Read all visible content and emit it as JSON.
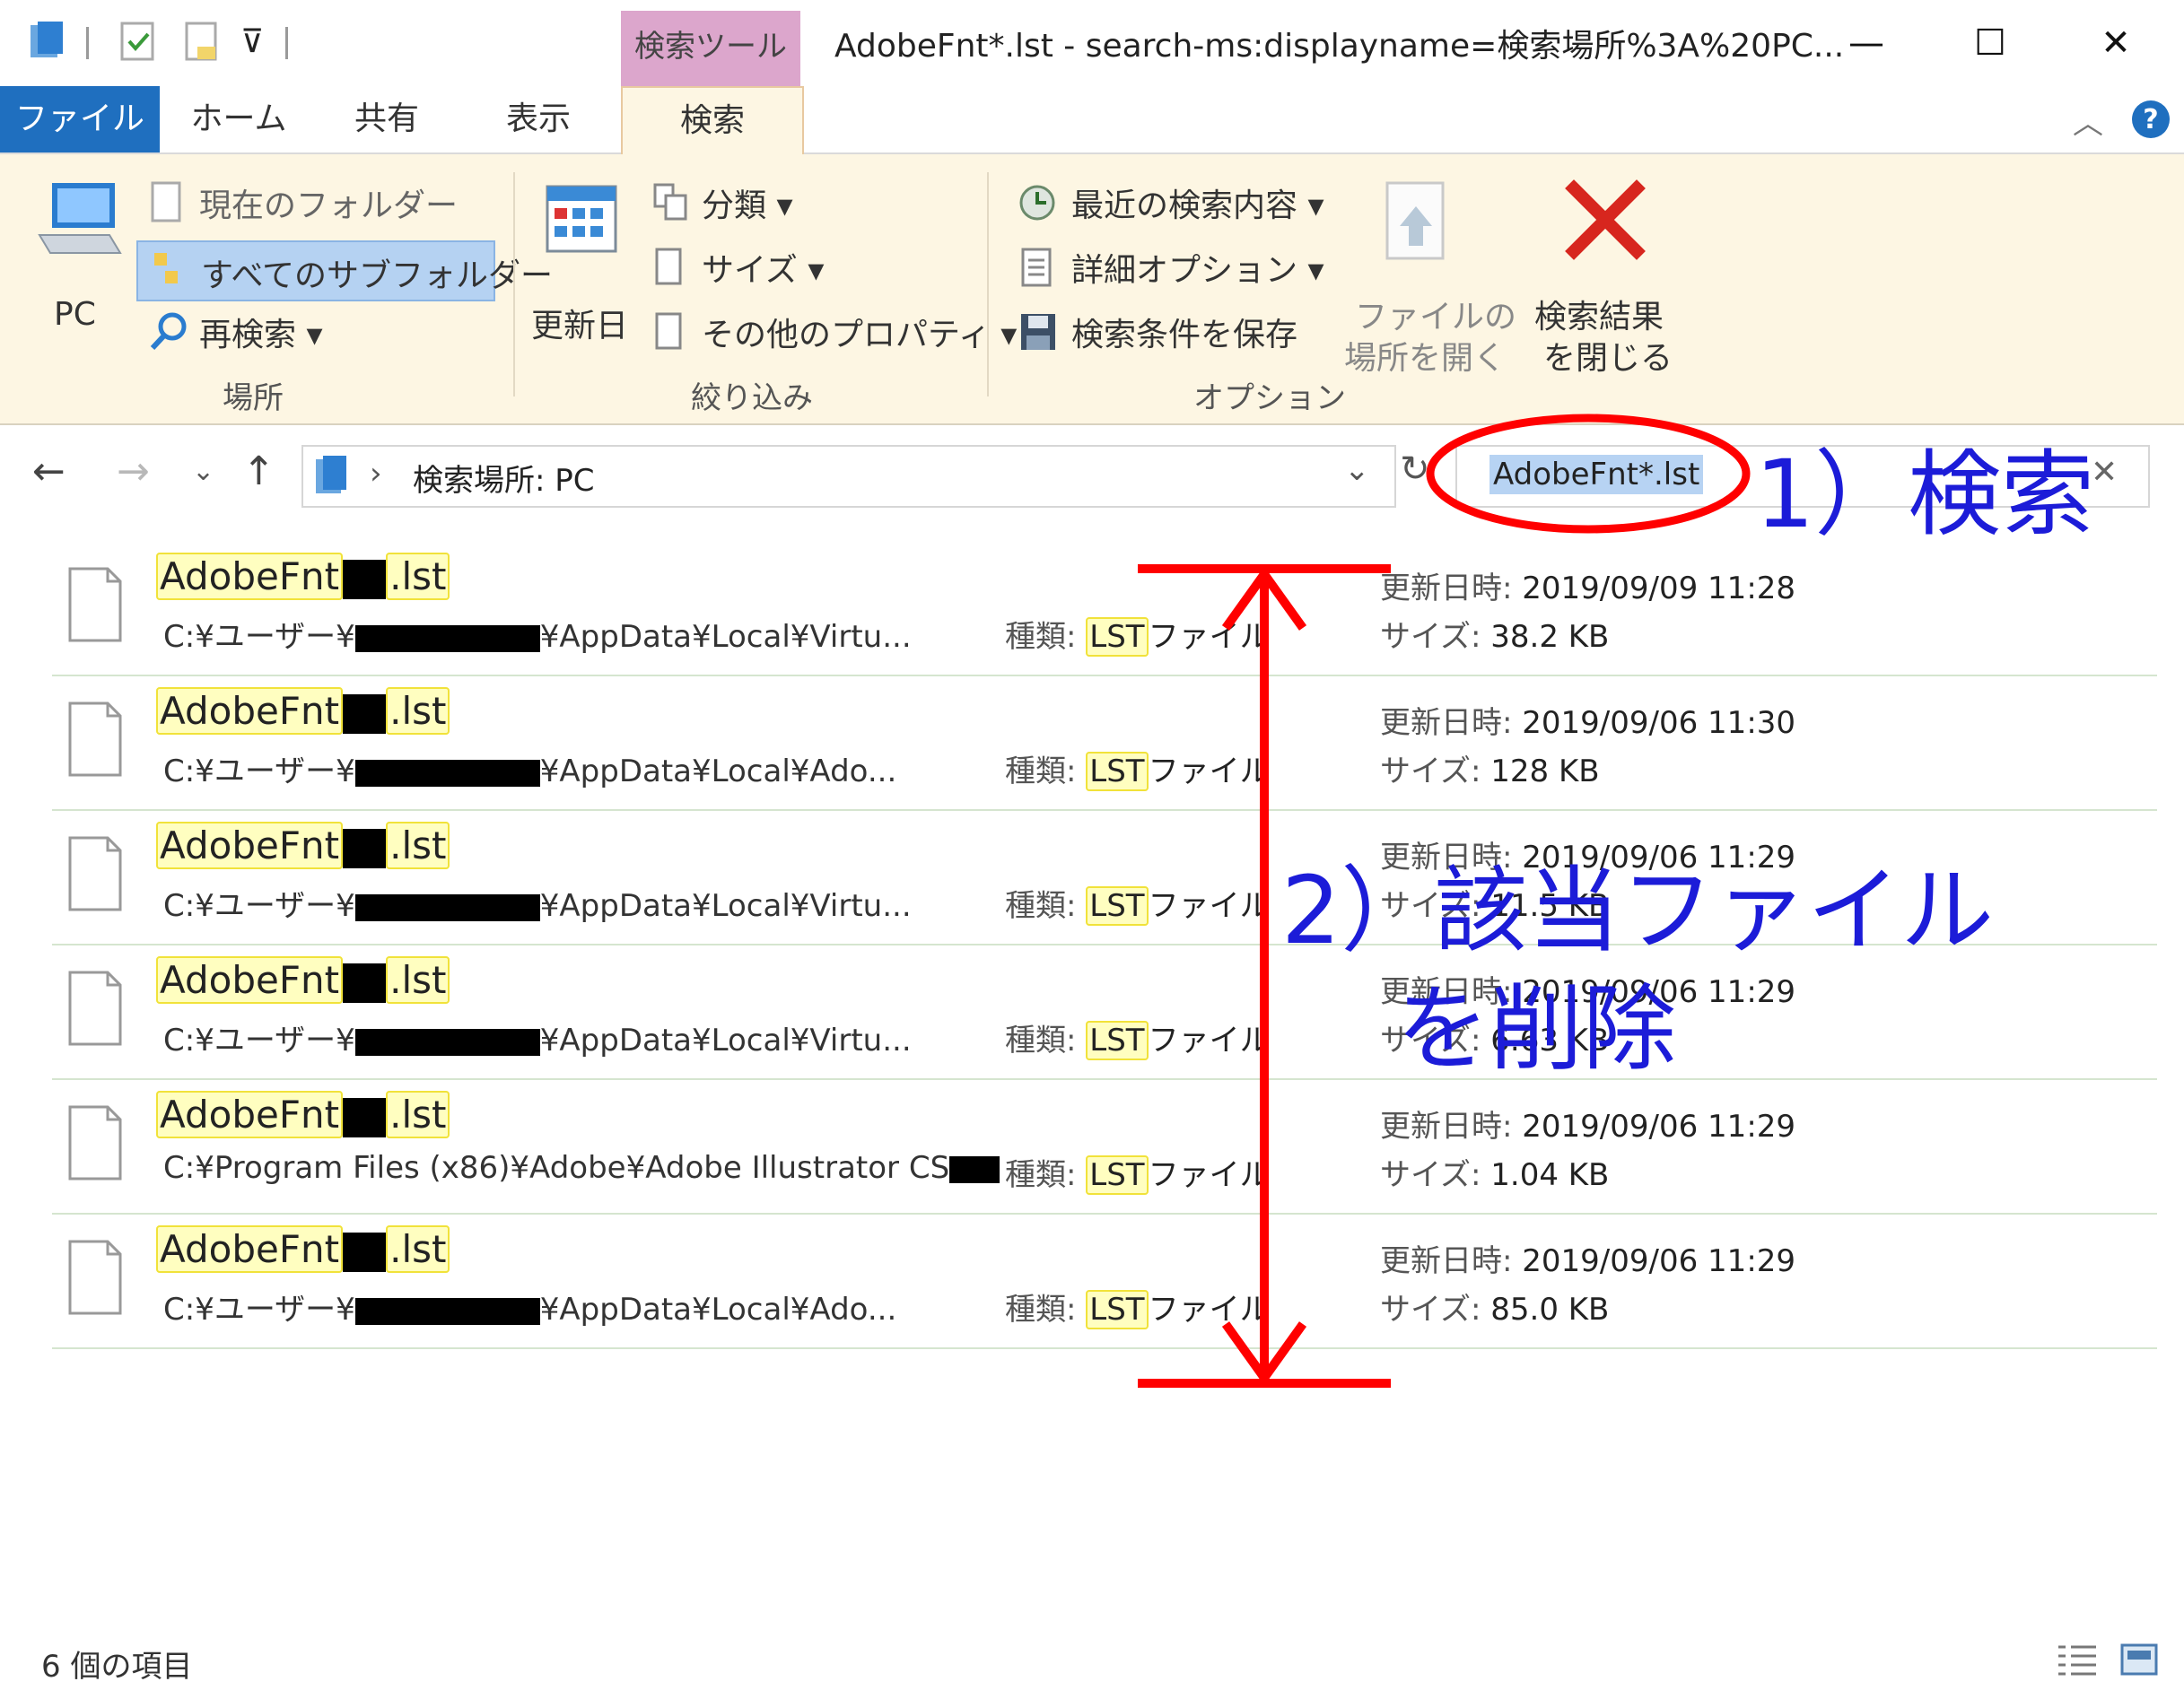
{
  "window": {
    "title": "AdobeFnt*.lst - search-ms:displayname=検索場所%3A%20PC...",
    "context_tab": "検索ツール",
    "minimize": "—",
    "maximize": "☐",
    "close": "✕"
  },
  "tabs": [
    "ファイル",
    "ホーム",
    "共有",
    "表示",
    "検索"
  ],
  "ribbon": {
    "pc_label": "PC",
    "current_folder": "現在のフォルダー",
    "all_subfolders": "すべてのサブフォルダー",
    "research": "再検索 ▾",
    "group_location": "場所",
    "date_modified": "更新日",
    "kind": "分類 ▾",
    "size": "サイズ ▾",
    "other_props": "その他のプロパティ ▾",
    "group_refine": "絞り込み",
    "recent_searches": "最近の検索内容 ▾",
    "advanced_options": "詳細オプション ▾",
    "save_search": "検索条件を保存",
    "group_options": "オプション",
    "open_location_line1": "ファイルの",
    "open_location_line2": "場所を開く",
    "close_results_line1": "検索結果",
    "close_results_line2": "を閉じる"
  },
  "address": {
    "breadcrumb_sep": "›",
    "location": "検索場所: PC",
    "search_value": "AdobeFnt*.lst"
  },
  "results": [
    {
      "name_prefix": "AdobeFnt",
      "name_suffix": ".lst",
      "path_prefix": "C:¥ユーザー¥",
      "path_suffix": "¥AppData¥Local¥Virtu...",
      "type_label": "種類:",
      "type_ext": "LST",
      "type_rest": "ファイル",
      "date_label": "更新日時:",
      "date": "2019/09/09 11:28",
      "size_label": "サイズ:",
      "size": "38.2 KB"
    },
    {
      "name_prefix": "AdobeFnt",
      "name_suffix": ".lst",
      "path_prefix": "C:¥ユーザー¥",
      "path_suffix": "¥AppData¥Local¥Ado...",
      "type_label": "種類:",
      "type_ext": "LST",
      "type_rest": "ファイル",
      "date_label": "更新日時:",
      "date": "2019/09/06 11:30",
      "size_label": "サイズ:",
      "size": "128 KB"
    },
    {
      "name_prefix": "AdobeFnt",
      "name_suffix": ".lst",
      "path_prefix": "C:¥ユーザー¥",
      "path_suffix": "¥AppData¥Local¥Virtu...",
      "type_label": "種類:",
      "type_ext": "LST",
      "type_rest": "ファイル",
      "date_label": "更新日時:",
      "date": "2019/09/06 11:29",
      "size_label": "サイズ:",
      "size": "11.5 KB"
    },
    {
      "name_prefix": "AdobeFnt",
      "name_suffix": ".lst",
      "path_prefix": "C:¥ユーザー¥",
      "path_suffix": "¥AppData¥Local¥Virtu...",
      "type_label": "種類:",
      "type_ext": "LST",
      "type_rest": "ファイル",
      "date_label": "更新日時:",
      "date": "2019/09/06 11:29",
      "size_label": "サイズ:",
      "size": "6.63 KB"
    },
    {
      "name_prefix": "AdobeFnt",
      "name_suffix": ".lst",
      "path_prefix": "C:¥Program Files (x86)¥Adobe¥Adobe Illustrator CS",
      "path_suffix": "",
      "type_label": "種類:",
      "type_ext": "LST",
      "type_rest": "ファイル",
      "date_label": "更新日時:",
      "date": "2019/09/06 11:29",
      "size_label": "サイズ:",
      "size": "1.04 KB"
    },
    {
      "name_prefix": "AdobeFnt",
      "name_suffix": ".lst",
      "path_prefix": "C:¥ユーザー¥",
      "path_suffix": "¥AppData¥Local¥Ado...",
      "type_label": "種類:",
      "type_ext": "LST",
      "type_rest": "ファイル",
      "date_label": "更新日時:",
      "date": "2019/09/06 11:29",
      "size_label": "サイズ:",
      "size": "85.0 KB"
    }
  ],
  "status": {
    "item_count": "6 個の項目"
  },
  "annotations": {
    "step1": "1）検索",
    "step2_line1": "2）該当ファイル",
    "step2_line2": "を削除",
    "color": "#ff0000",
    "text_color": "#1c1cd8"
  }
}
